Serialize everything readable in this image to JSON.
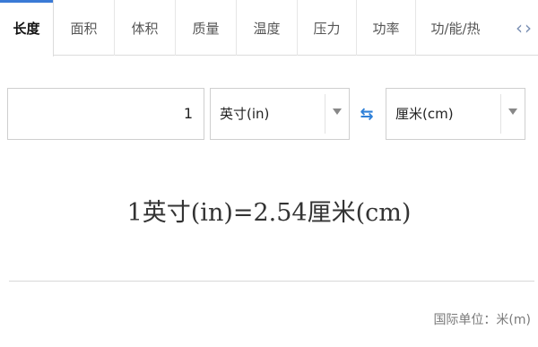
{
  "tabs": [
    "长度",
    "面积",
    "体积",
    "质量",
    "温度",
    "压力",
    "功率",
    "功/能/热"
  ],
  "tabs_prev": "‹",
  "tabs_next": "›",
  "converter": {
    "input_value": "1",
    "from_unit": "英寸(in)",
    "to_unit": "厘米(cm)",
    "swap_icon": "⇆"
  },
  "result": "1英寸(in)=2.54厘米(cm)",
  "footer": "国际单位：米(m)",
  "colors": {
    "accent": "#3a7ad6",
    "swap": "#2f80d8"
  }
}
